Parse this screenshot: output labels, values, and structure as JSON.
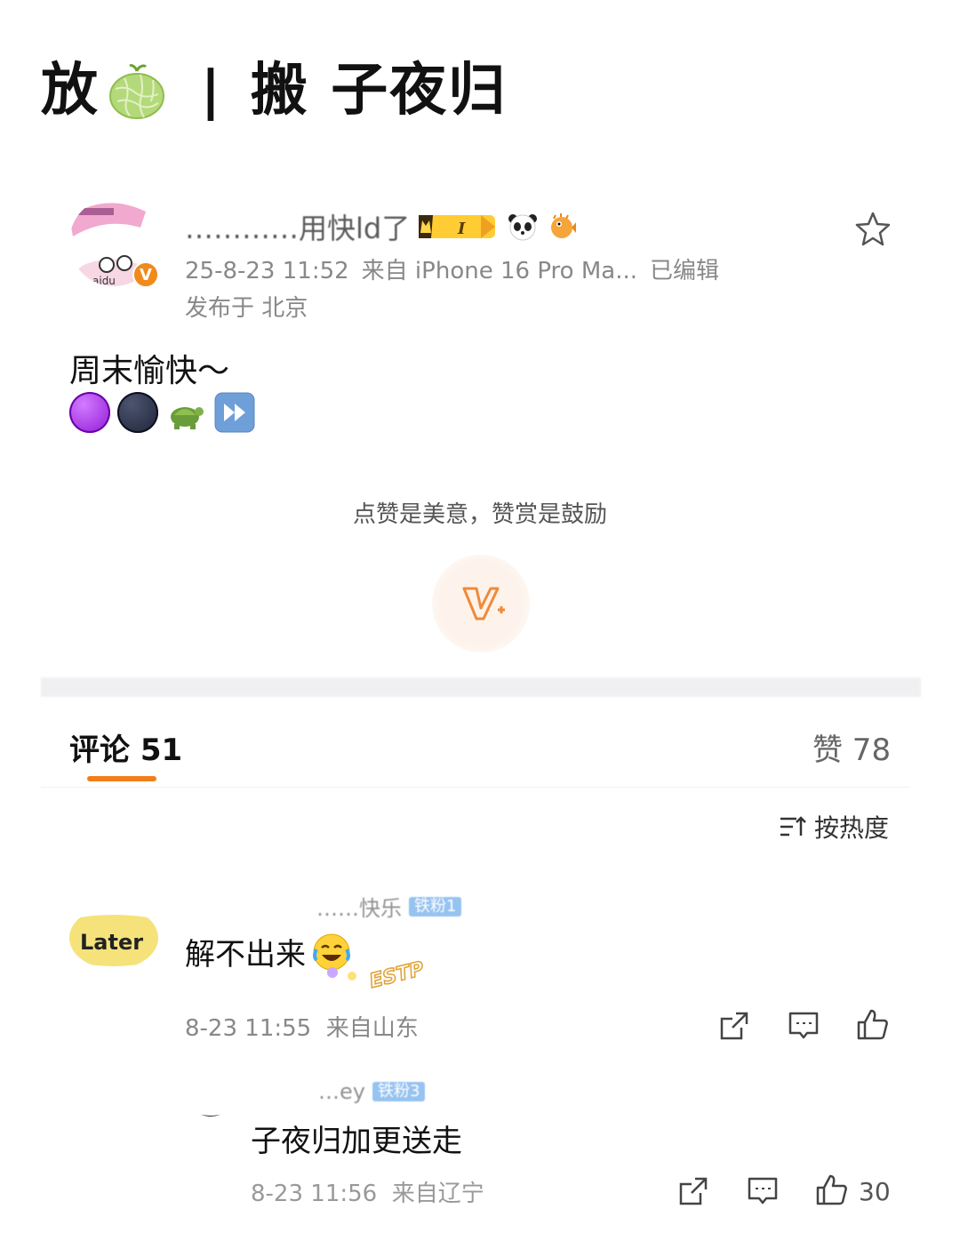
{
  "header": {
    "title_left": "放",
    "separator": "|",
    "title_right": "搬 子夜归"
  },
  "post": {
    "username": "…………用快ld了",
    "meta_time": "25-8-23 11:52",
    "meta_source": "来自 iPhone 16 Pro Ma...",
    "meta_edited": "已编辑",
    "location": "发布于 北京",
    "text": "周末愉快～",
    "avatar_label": "aidu",
    "verified_mark": "V"
  },
  "reward": {
    "prompt": "点赞是美意，赞赏是鼓励",
    "button_label": "V+"
  },
  "tabs": {
    "comments": "评论 51",
    "likes": "赞 78"
  },
  "sort": {
    "label": "按热度"
  },
  "comments": [
    {
      "username": "……快乐",
      "badge": "铁粉1",
      "avatar_text": "Later",
      "text": "解不出来",
      "sticker_text": "ESTP",
      "time": "8-23 11:55",
      "source": "来自山东",
      "likes": ""
    },
    {
      "username": "…ey",
      "badge": "铁粉3",
      "text": "子夜归加更送走",
      "time": "8-23 11:56",
      "source": "来自辽宁",
      "likes": "30"
    }
  ],
  "colors": {
    "accent": "#f07f1b",
    "meta": "#888888",
    "fan_badge": "#7eb5ee"
  }
}
